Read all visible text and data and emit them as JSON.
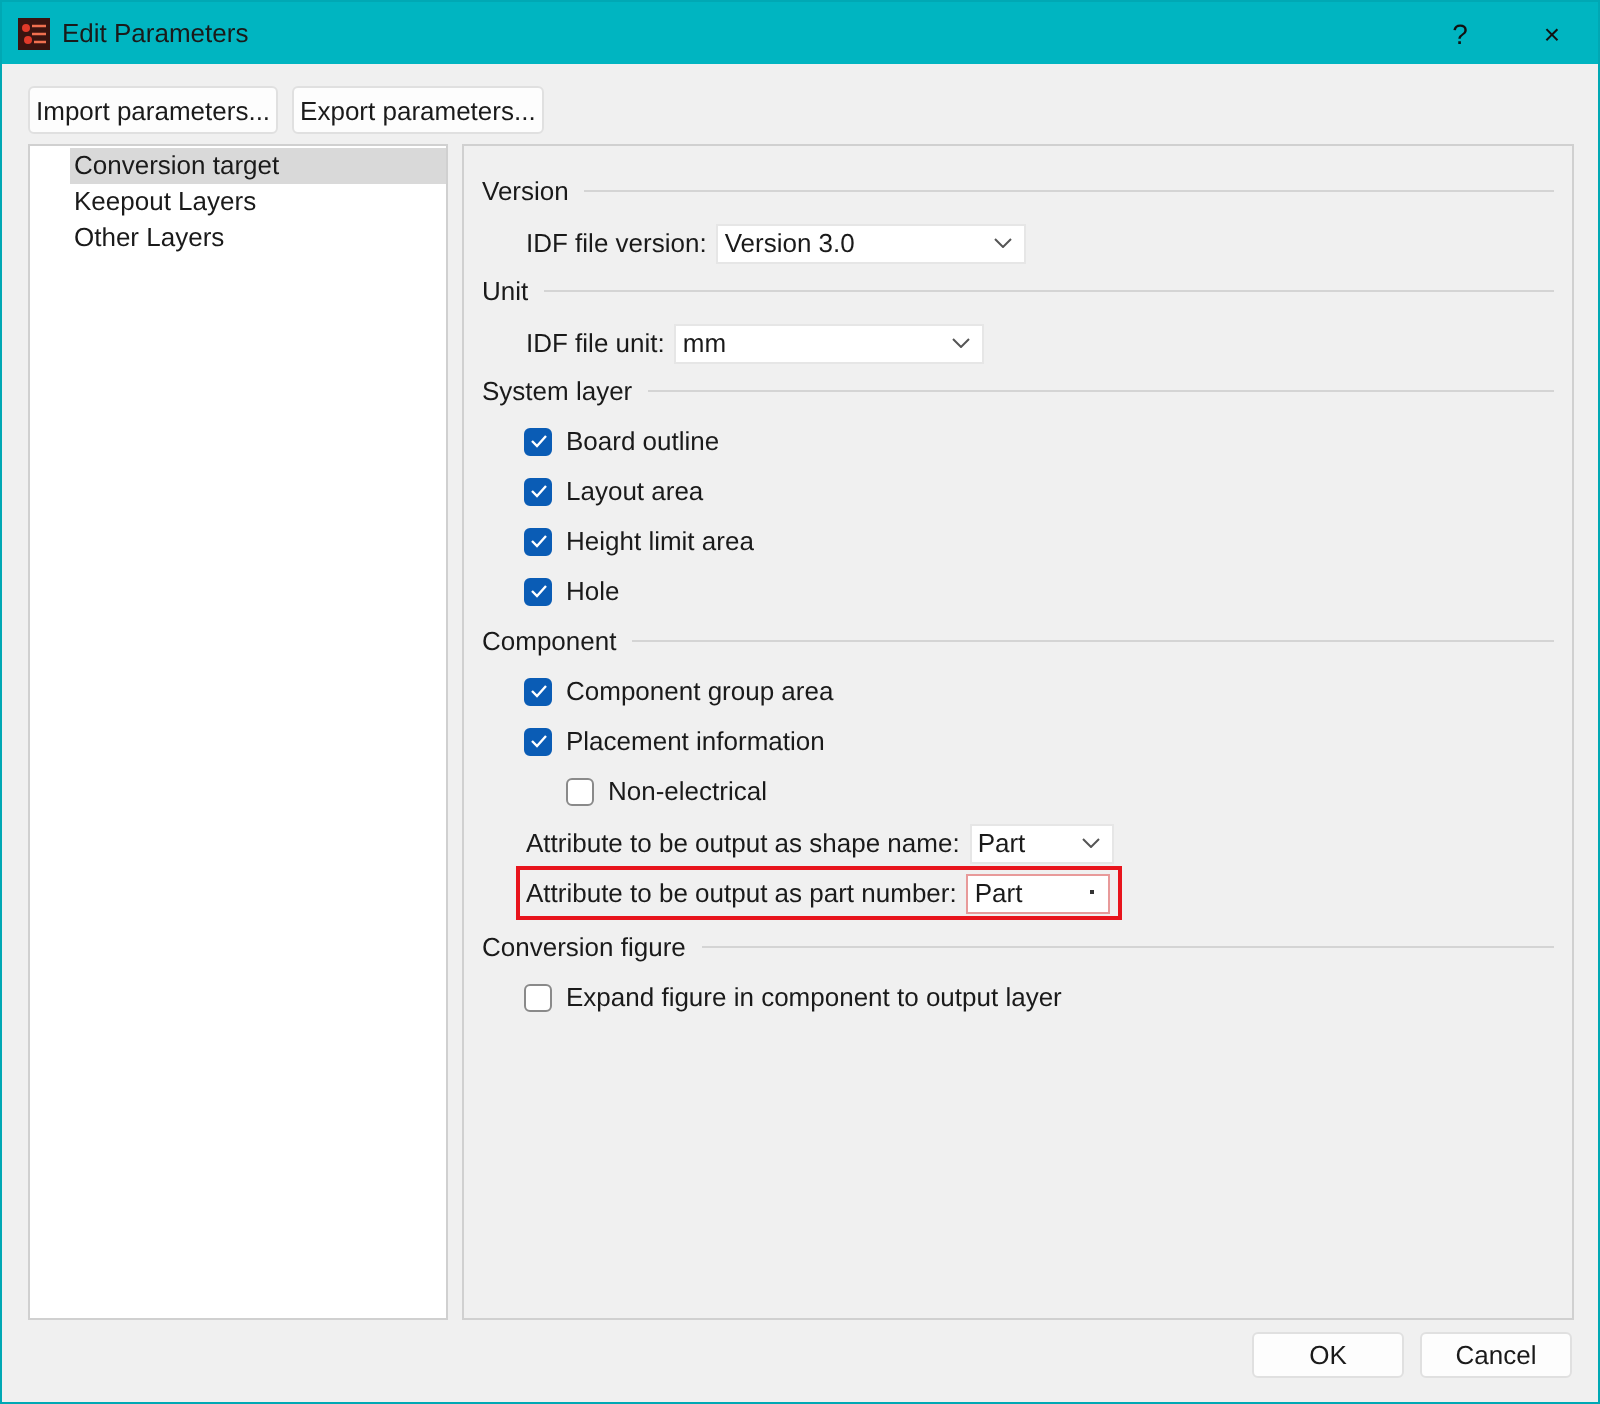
{
  "window": {
    "title": "Edit Parameters",
    "title_buttons": [
      "?",
      "×"
    ]
  },
  "toolbar": [
    "Import parameters...",
    "Export parameters..."
  ],
  "tree": [
    {
      "label": "Conversion target",
      "selected": true
    },
    {
      "label": "Keepout Layers",
      "selected": false
    },
    {
      "label": "Other Layers",
      "selected": false
    }
  ],
  "sections": [
    {
      "title": "Version",
      "items": [
        {
          "kind": "combo",
          "label": "IDF file version:",
          "value": "Version 3.0",
          "highlighted": false
        }
      ]
    },
    {
      "title": "Unit",
      "items": [
        {
          "kind": "combo",
          "label": "IDF file unit:",
          "value": "mm",
          "highlighted": false
        }
      ]
    },
    {
      "title": "System layer",
      "items": [
        {
          "kind": "checkbox",
          "label": "Board outline",
          "checked": true
        },
        {
          "kind": "checkbox",
          "label": "Layout area",
          "checked": true
        },
        {
          "kind": "checkbox",
          "label": "Height limit area",
          "checked": true
        },
        {
          "kind": "checkbox",
          "label": "Hole",
          "checked": true
        }
      ]
    },
    {
      "title": "Component",
      "items": [
        {
          "kind": "checkbox",
          "label": "Component group area",
          "checked": true
        },
        {
          "kind": "checkbox",
          "label": "Placement information",
          "checked": true,
          "children": [
            {
              "kind": "checkbox",
              "label": "Non-electrical",
              "checked": false
            }
          ]
        },
        {
          "kind": "combo",
          "label": "Attribute to be output as shape name:",
          "value": "Part",
          "highlighted": false
        },
        {
          "kind": "combo",
          "label": "Attribute to be output as part number:",
          "value": "Part",
          "highlighted": true
        }
      ]
    },
    {
      "title": "Conversion figure",
      "items": [
        {
          "kind": "checkbox",
          "label": "Expand figure in component to output layer",
          "checked": false
        }
      ]
    }
  ],
  "buttons": [
    "OK",
    "Cancel"
  ]
}
